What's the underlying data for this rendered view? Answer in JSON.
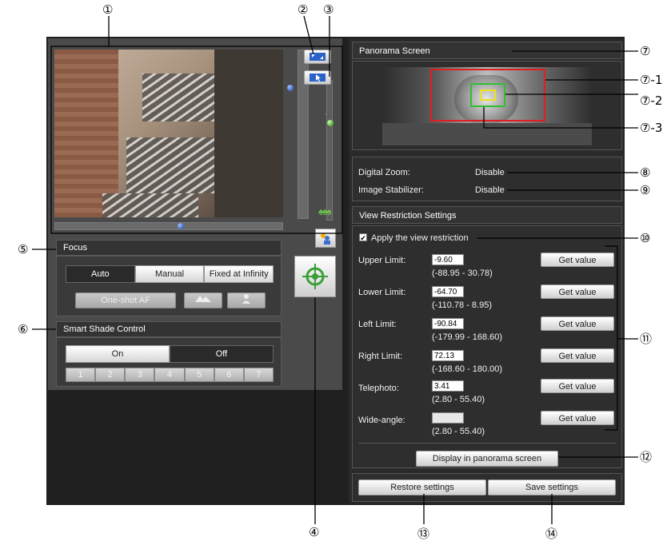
{
  "callouts": {
    "c1": "①",
    "c2": "②",
    "c3": "③",
    "c4": "④",
    "c5": "⑤",
    "c6": "⑥",
    "c7": "⑦",
    "c7_1": "⑦-1",
    "c7_2": "⑦-2",
    "c7_3": "⑦-3",
    "c8": "⑧",
    "c9": "⑨",
    "c10": "⑩",
    "c11": "⑪",
    "c12": "⑫",
    "c13": "⑬",
    "c14": "⑭"
  },
  "icons": {
    "fullscreen": "expand-icon",
    "pointer": "cursor-icon",
    "backlight": "backlight-compensation-icon",
    "ptz_center": "crosshair-icon",
    "far_focus": "mountain-icon",
    "near_focus": "person-icon"
  },
  "focus": {
    "title": "Focus",
    "modes": [
      "Auto",
      "Manual",
      "Fixed at Infinity"
    ],
    "selected_mode": "Auto",
    "one_shot_label": "One-shot AF"
  },
  "shade": {
    "title": "Smart Shade Control",
    "toggle": [
      "On",
      "Off"
    ],
    "selected": "Off",
    "levels": [
      "1",
      "2",
      "3",
      "4",
      "5",
      "6",
      "7"
    ]
  },
  "panorama": {
    "title": "Panorama Screen"
  },
  "status": {
    "digital_zoom_label": "Digital Zoom:",
    "digital_zoom_value": "Disable",
    "stabilizer_label": "Image Stabilizer:",
    "stabilizer_value": "Disable"
  },
  "restriction": {
    "title": "View Restriction Settings",
    "apply_label": "Apply the view restriction",
    "apply_checked": true,
    "rows": [
      {
        "label": "Upper Limit:",
        "value": "-9.60",
        "range": "(-88.95 - 30.78)",
        "button": "Get value"
      },
      {
        "label": "Lower Limit:",
        "value": "-64.70",
        "range": "(-110.78 - 8.95)",
        "button": "Get value"
      },
      {
        "label": "Left Limit:",
        "value": "-90.84",
        "range": "(-179.99 - 168.60)",
        "button": "Get value"
      },
      {
        "label": "Right Limit:",
        "value": "72.13",
        "range": "(-168.60 - 180.00)",
        "button": "Get value"
      },
      {
        "label": "Telephoto:",
        "value": "3.41",
        "range": "(2.80 - 55.40)",
        "button": "Get value"
      },
      {
        "label": "Wide-angle:",
        "value": "",
        "range": "(2.80 - 55.40)",
        "button": "Get value"
      }
    ],
    "display_btn": "Display in panorama screen"
  },
  "footer": {
    "restore": "Restore settings",
    "save": "Save settings"
  },
  "colors": {
    "app_bg": "#202020",
    "panel": "#4a4a4a",
    "restriction_box": "#e02020",
    "zoom_box": "#f0e020",
    "frame_box": "#30c030"
  }
}
